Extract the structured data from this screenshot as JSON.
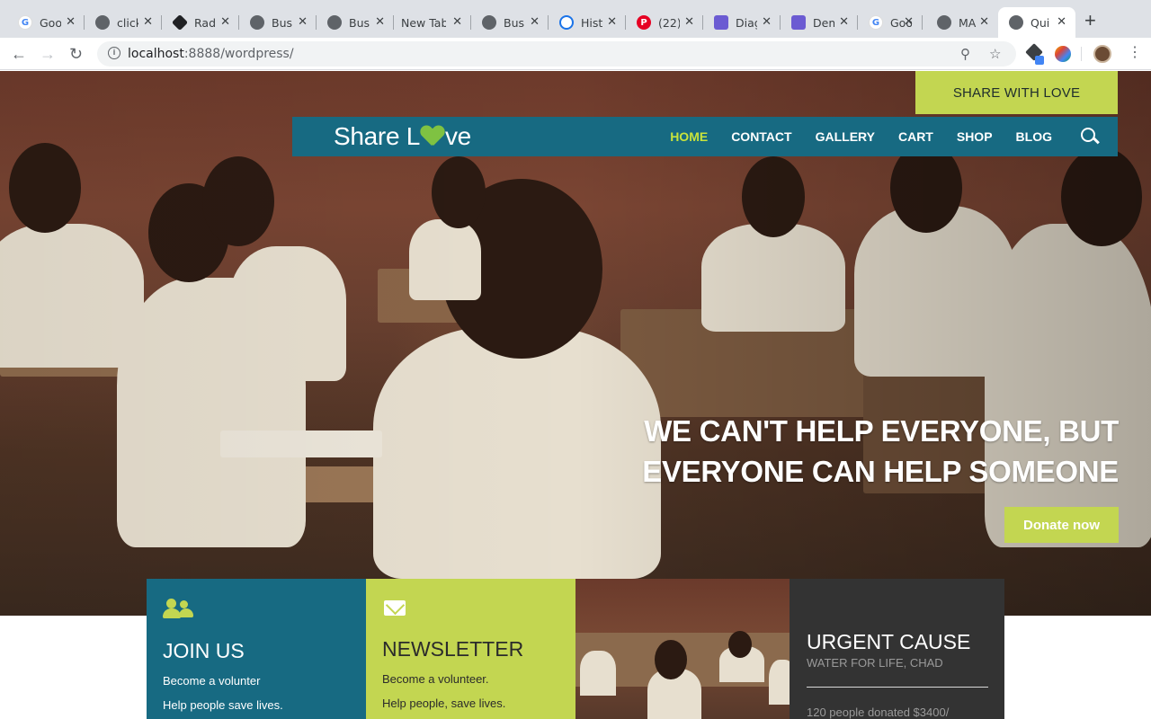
{
  "browser": {
    "tabs": [
      {
        "title": "Goo",
        "icon": "google-icon",
        "color": "#4285f4"
      },
      {
        "title": "click",
        "icon": "globe-icon",
        "color": "#5f6368"
      },
      {
        "title": "Rad",
        "icon": "radix-icon",
        "color": "#202124"
      },
      {
        "title": "Bus",
        "icon": "globe-icon",
        "color": "#5f6368"
      },
      {
        "title": "Bus",
        "icon": "globe-icon",
        "color": "#5f6368"
      },
      {
        "title": "New Tab",
        "icon": "",
        "color": ""
      },
      {
        "title": "Bus",
        "icon": "globe-icon",
        "color": "#5f6368"
      },
      {
        "title": "Hist",
        "icon": "history-icon",
        "color": "#1a73e8"
      },
      {
        "title": "(22)",
        "icon": "pinterest-icon",
        "color": "#e60023"
      },
      {
        "title": "Diag",
        "icon": "diagram-icon",
        "color": "#6b5bd2"
      },
      {
        "title": "Dem",
        "icon": "demo-icon",
        "color": "#6b5bd2"
      },
      {
        "title": "Goo",
        "icon": "google-icon",
        "color": "#4285f4"
      },
      {
        "title": "MA",
        "icon": "github-icon",
        "color": "#5f6368"
      },
      {
        "title": "Qui",
        "icon": "github-icon",
        "color": "#5f6368",
        "active": true
      }
    ],
    "url_host": "localhost",
    "url_rest": ":8888/wordpress/"
  },
  "site": {
    "top_cta": "SHARE WITH LOVE",
    "logo_before": "Share L",
    "logo_after": "ve",
    "menu": [
      "HOME",
      "CONTACT",
      "GALLERY",
      "CART",
      "SHOP",
      "BLOG"
    ],
    "headline_line1": "WE CAN'T HELP EVERYONE, BUT",
    "headline_line2": "EVERYONE CAN HELP SOMEONE",
    "donate_label": "Donate now",
    "accent_color": "#c3d651",
    "brand_color": "#176a82"
  },
  "boxes": {
    "join": {
      "title": "JOIN US",
      "line1": "Become a volunter",
      "line2": "Help people save lives."
    },
    "newsletter": {
      "title": "NEWSLETTER",
      "line1": "Become a volunteer.",
      "line2": "Help people, save lives."
    },
    "urgent": {
      "title": "URGENT CAUSE",
      "subtitle": "WATER FOR LIFE, CHAD",
      "stat": "120 people donated $3400/"
    }
  }
}
